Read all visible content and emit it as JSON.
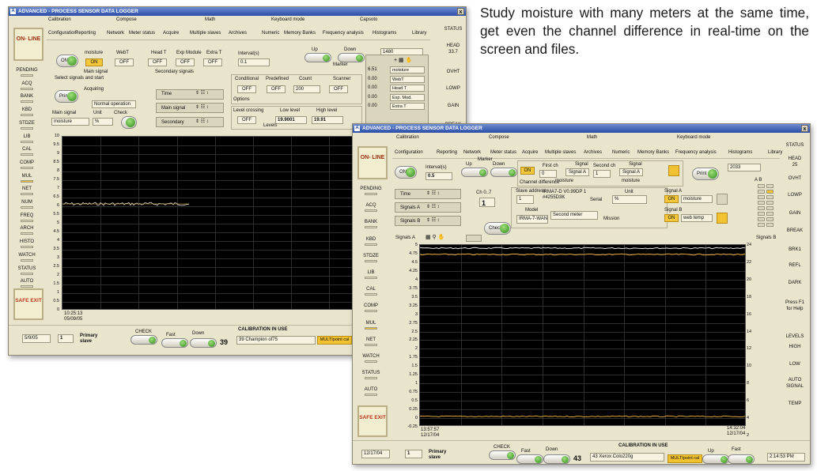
{
  "description": "Study moisture with many meters at the same time, get even the channel difference in real-time on the screen and files.",
  "windows": {
    "back": {
      "title": "ADVANCED - PROCESS SENSOR DATA LOGGER",
      "close": "x",
      "menu_top": [
        "Calibration",
        "Compose",
        "Math",
        "Keyboard mode",
        "Capsoto"
      ],
      "menu_bottom": [
        "Configuration",
        "Reporting",
        "Network",
        "Meter status",
        "Acquire",
        "Multiple slaves",
        "Archives",
        "Numeric",
        "Memory Banks",
        "Frequency analysis",
        "Histograms",
        "Library"
      ],
      "online": "ON- LINE",
      "left": [
        "PENDING",
        "ACQ",
        "BANK",
        "KBD",
        "STDZE",
        "LIB",
        "CAL",
        "COMP",
        "MUL",
        "NET",
        "NUM",
        "FREQ",
        "ARCH",
        "HISTO",
        "WATCH",
        "STATUS",
        "AUTO"
      ],
      "safe_exit": "SAFE EXIT",
      "right": [
        "STATUS",
        "HEAD",
        "33.7",
        "OVHT",
        "LOWP",
        "GAIN",
        "BREAK"
      ],
      "on": "ON",
      "moisture": "moisture",
      "webT": "WebT",
      "headT": "Head T",
      "expModule": "Exp Module",
      "extraT": "Extra T",
      "onv": "ON",
      "off": "OFF",
      "main_signal": "Main signal",
      "secondary_signals": "Secondary signals",
      "select_start": "Select signals and start",
      "print": "Print",
      "acquiring": "Acquiring",
      "normal_op": "Normal operation",
      "check": "Check",
      "main_signal2": "Main signal",
      "unit": "Unit",
      "moisture2": "moisture",
      "pct": "%",
      "time": "Time",
      "mainsig": "Main signal",
      "secondary": "Secondary",
      "interval": "Interval(s)",
      "interval_val": "0.1",
      "up": "Up",
      "down": "Down",
      "marker": "Marker",
      "num": "1480",
      "conditional": "Conditional",
      "predefined": "Predefined",
      "count": "Count",
      "count_val": "200",
      "scanner": "Scanner",
      "options": "Options",
      "level_crossing": "Level crossing",
      "low_level": "Low level",
      "high_level": "High level",
      "levels": "Levels",
      "low_val": "19.9001",
      "high_val": "19.91",
      "readings": [
        {
          "v": "6.51",
          "n": "moisture"
        },
        {
          "v": "0.00",
          "n": "WebT"
        },
        {
          "v": "0.00",
          "n": "Head T"
        },
        {
          "v": "0.00",
          "n": "Exp. Mod."
        },
        {
          "v": "0.00",
          "n": "Extra T"
        }
      ],
      "yaxis": [
        "10",
        "9.5",
        "9",
        "8.5",
        "8",
        "7.5",
        "7",
        "6.5",
        "6",
        "5.5",
        "5",
        "4.5",
        "4",
        "3.5",
        "3",
        "2.5",
        "2",
        "1.5",
        "1",
        "0.5",
        "0"
      ],
      "xstart": "10:25:13",
      "xdate": "05/09/05",
      "date": "5/9/05",
      "slave_num": "1",
      "primary": "Primary slave",
      "check2": "CHECK",
      "fast": "Fast",
      "down2": "Down",
      "count2": "39",
      "cal_title": "CALIBRATION IN USE",
      "cal_name": "39 Champion of75",
      "mult": "MULTIpoint cal"
    },
    "front": {
      "title": "ADVANCED - PROCESS SENSOR DATA LOGGER",
      "close": "x",
      "menu_top": [
        "Calibration",
        "Compose",
        "Math",
        "Keyboard mode"
      ],
      "menu_bottom": [
        "Configuration",
        "Reporting",
        "Network",
        "Meter status",
        "Acquire",
        "Multiple slaves",
        "Archives",
        "Numeric",
        "Memory Banks",
        "Frequency analysis",
        "Histograms",
        "Library"
      ],
      "online": "ON- LINE",
      "left": [
        "PENDING",
        "ACQ",
        "BANK",
        "KBD",
        "STDZE",
        "LIB",
        "CAL",
        "COMP",
        "MUL",
        "NET",
        "WATCH",
        "STATUS",
        "AUTO"
      ],
      "safe_exit": "SAFE EXIT",
      "right": [
        "STATUS",
        "HEAD",
        "25",
        "OVHT",
        "LOWP",
        "GAIN",
        "BREAK",
        "BRK1",
        "REFL",
        "DARK",
        "Press F1 for Help",
        "LEVELS",
        "HIGH",
        "LOW",
        "AUTO SIGNAL",
        "TEMP"
      ],
      "on": "ON",
      "interval": "Interval(s)",
      "interval_val": "0.5",
      "up": "Up",
      "down": "Down",
      "marker": "Marker",
      "on2": "ON",
      "first_ch": "First ch",
      "first_val": "0",
      "signal": "Signal",
      "signalA": "Signal A",
      "second_ch": "Second ch",
      "second_val": "1",
      "signal2": "Signal",
      "signalA2": "Signal A",
      "ch_diff": "Channel difference",
      "moisture": "moisture",
      "moisture2": "moisture",
      "print": "Print",
      "num": "2033",
      "time": "Time",
      "signalsA": "Signals A",
      "signalsB": "Signals B",
      "ch07": "Ch 0..7",
      "ch_val": "1",
      "slave_address": "Slave address",
      "slave_val": "1",
      "model_info": "IRMA7-D V0.99DP 1 #4255D3K",
      "serial": "Serial",
      "unit": "Unit",
      "pct": "%",
      "model": "Model",
      "model_val": "IRMA-7-WAND",
      "second_meter": "Second meter",
      "mission": "Mission",
      "sigA": "Signal A",
      "onA": "ON",
      "moistureA": "moisture",
      "sigB": "Signal B",
      "onB": "ON",
      "webtemp": "web temp",
      "check": "Check",
      "signals_a": "Signals A",
      "signals_b": "Signals B",
      "ab": "A B",
      "left_axis": [
        "5",
        "4.75",
        "4.5",
        "4.25",
        "4",
        "3.75",
        "3.5",
        "3.25",
        "3",
        "2.75",
        "2.5",
        "2.25",
        "2",
        "1.75",
        "1.5",
        "1.25",
        "1",
        "0.75",
        "0.5",
        "0.25",
        "0",
        "-0.25"
      ],
      "right_axis": [
        "24",
        "22",
        "20",
        "18",
        "16",
        "14",
        "12",
        "10",
        "8",
        "6",
        "4",
        "2"
      ],
      "x_start": "13:57:57",
      "x_start_date": "12/17/04",
      "x_end": "14:32:04",
      "x_end_date": "12/17/04",
      "date": "12/17/04",
      "slave_num": "1",
      "primary": "Primary slave",
      "check2": "CHECK",
      "fast": "Fast",
      "down2": "Down",
      "count2": "43",
      "cal_title": "CALIBRATION IN USE",
      "cal_name": "43 Xerox Colo220g",
      "mult": "MULTIpoint cal",
      "up2": "Up",
      "fast2": "Fast",
      "time_now": "2:14:53 PM"
    }
  }
}
